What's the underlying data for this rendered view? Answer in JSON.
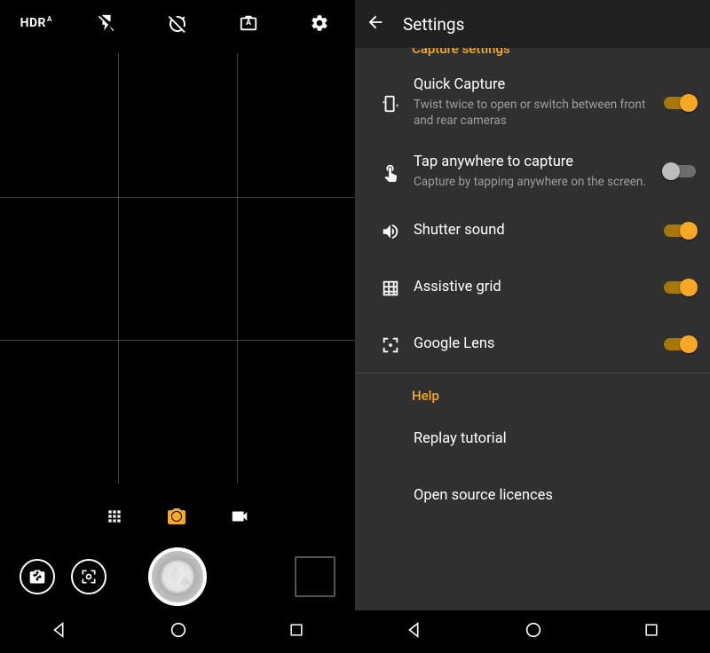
{
  "camera": {
    "hdr_label": "HDR",
    "auto_label": "A"
  },
  "settings": {
    "title": "Settings",
    "section_cut": "Capture settings",
    "items": {
      "quick_capture": {
        "title": "Quick Capture",
        "subtitle": "Twist twice to open or switch between front and rear cameras"
      },
      "tap_anywhere": {
        "title": "Tap anywhere to capture",
        "subtitle": "Capture by tapping anywhere on the screen."
      },
      "shutter_sound": {
        "title": "Shutter sound"
      },
      "assistive_grid": {
        "title": "Assistive grid"
      },
      "google_lens": {
        "title": "Google Lens"
      }
    },
    "help": {
      "header": "Help",
      "replay": "Replay tutorial",
      "oss": "Open source licences"
    }
  }
}
